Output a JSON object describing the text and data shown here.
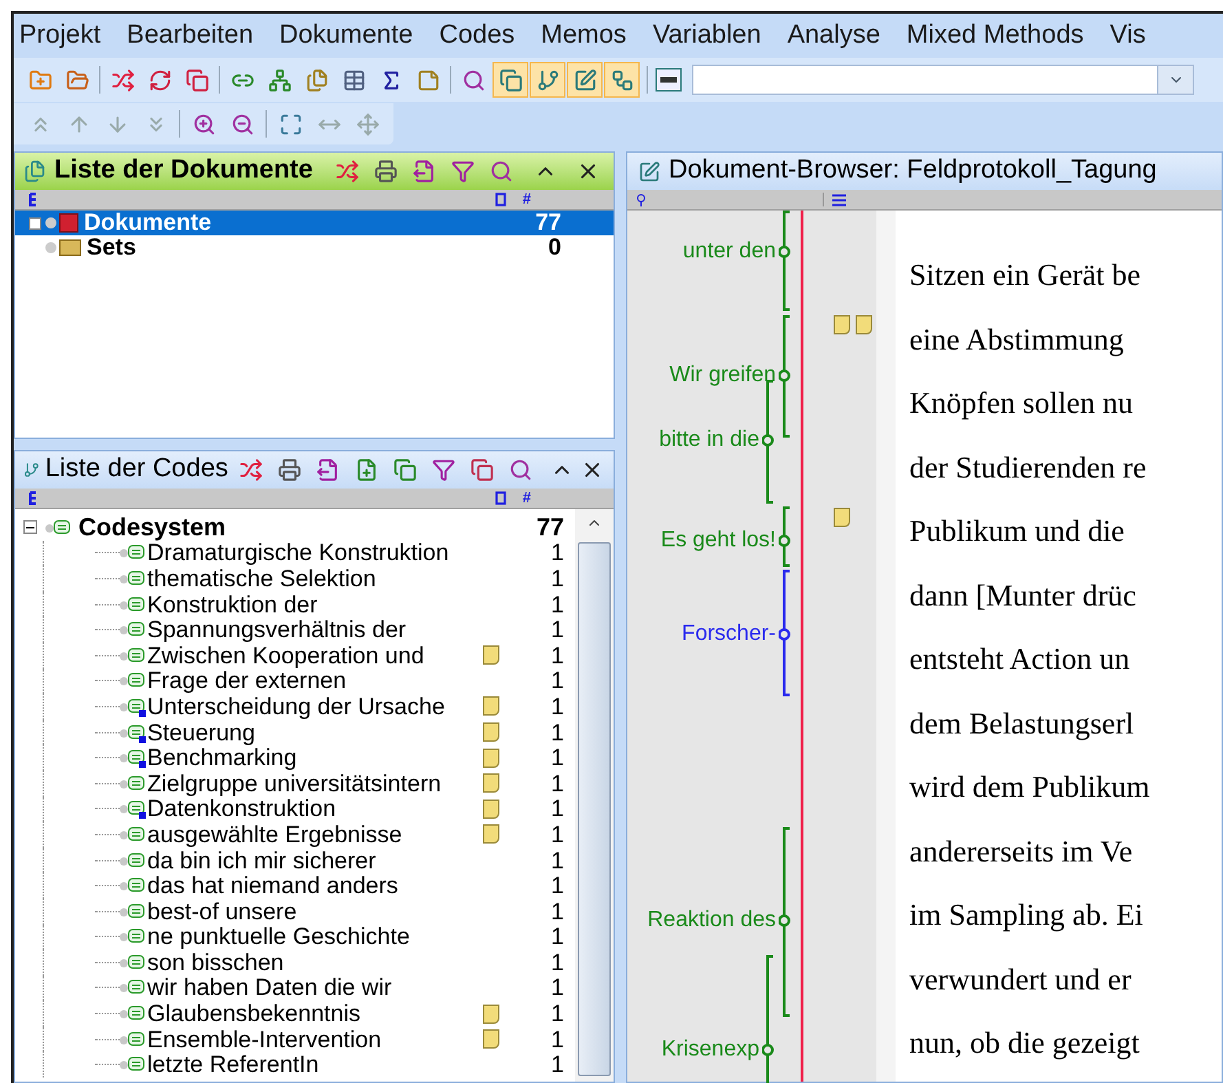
{
  "menu": [
    "Projekt",
    "Bearbeiten",
    "Dokumente",
    "Codes",
    "Memos",
    "Variablen",
    "Analyse",
    "Mixed Methods",
    "Vis"
  ],
  "mode_buttons": [
    {
      "pressed": true
    },
    {
      "pressed": true
    },
    {
      "pressed": true
    },
    {
      "pressed": true
    }
  ],
  "documents_panel": {
    "title": "Liste der Dokumente",
    "count_header": "#",
    "items": [
      {
        "name": "Dokumente",
        "count": "77",
        "kind": "documents",
        "selected": true
      },
      {
        "name": "Sets",
        "count": "0",
        "kind": "sets",
        "selected": false
      }
    ]
  },
  "codes_panel": {
    "title": "Liste der Codes",
    "count_header": "#",
    "root": {
      "name": "Codesystem",
      "count": "77",
      "expanded": true
    },
    "codes": [
      {
        "name": "Dramaturgische Konstruktion",
        "count": "1",
        "memo": false,
        "marked": false
      },
      {
        "name": "thematische Selektion",
        "count": "1",
        "memo": false,
        "marked": false
      },
      {
        "name": "Konstruktion der",
        "count": "1",
        "memo": false,
        "marked": false
      },
      {
        "name": "Spannungsverhältnis der",
        "count": "1",
        "memo": false,
        "marked": false
      },
      {
        "name": "Zwischen Kooperation und",
        "count": "1",
        "memo": true,
        "marked": false
      },
      {
        "name": "Frage der externen",
        "count": "1",
        "memo": false,
        "marked": false
      },
      {
        "name": "Unterscheidung der Ursache",
        "count": "1",
        "memo": true,
        "marked": true
      },
      {
        "name": "Steuerung",
        "count": "1",
        "memo": true,
        "marked": true
      },
      {
        "name": "Benchmarking",
        "count": "1",
        "memo": true,
        "marked": true
      },
      {
        "name": "Zielgruppe  universitätsintern",
        "count": "1",
        "memo": true,
        "marked": false
      },
      {
        "name": "Datenkonstruktion",
        "count": "1",
        "memo": true,
        "marked": true
      },
      {
        "name": "ausgewählte Ergebnisse",
        "count": "1",
        "memo": true,
        "marked": false
      },
      {
        "name": "da bin ich mir sicherer",
        "count": "1",
        "memo": false,
        "marked": false
      },
      {
        "name": "das hat niemand anders",
        "count": "1",
        "memo": false,
        "marked": false
      },
      {
        "name": "best-of unsere",
        "count": "1",
        "memo": false,
        "marked": false
      },
      {
        "name": "ne punktuelle Geschichte",
        "count": "1",
        "memo": false,
        "marked": false
      },
      {
        "name": "son bisschen",
        "count": "1",
        "memo": false,
        "marked": false
      },
      {
        "name": "wir haben Daten die wir",
        "count": "1",
        "memo": false,
        "marked": false
      },
      {
        "name": "Glaubensbekenntnis",
        "count": "1",
        "memo": true,
        "marked": false
      },
      {
        "name": "Ensemble-Intervention",
        "count": "1",
        "memo": true,
        "marked": false
      },
      {
        "name": "letzte ReferentIn",
        "count": "1",
        "memo": false,
        "marked": false
      }
    ]
  },
  "browser": {
    "title": "Dokument-Browser: Feldprotokoll_Tagung",
    "segments": [
      {
        "label": "unter den",
        "color": "#1a8a1a"
      },
      {
        "label": "Wir greifen",
        "color": "#1a8a1a"
      },
      {
        "label": "bitte in die",
        "color": "#1a8a1a"
      },
      {
        "label": "Es geht los!",
        "color": "#1a8a1a"
      },
      {
        "label": "Forscher-",
        "color": "#2a2aee"
      },
      {
        "label": "Reaktion des",
        "color": "#1a8a1a"
      },
      {
        "label": "Krisenexp",
        "color": "#1a8a1a"
      }
    ],
    "lines": [
      "Sitzen ein Gerät be",
      "eine Abstimmung",
      "Knöpfen sollen nu",
      "der Studierenden re",
      "Publikum und die",
      "dann [Munter drüc",
      "entsteht Action un",
      "dem Belastungserl",
      "wird dem Publikum",
      "andererseits im Ve",
      "im Sampling ab. Ei",
      "verwundert und er",
      "nun, ob die gezeigt"
    ]
  }
}
